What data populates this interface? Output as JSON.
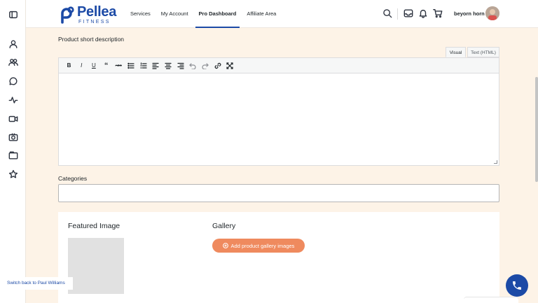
{
  "brand": {
    "name": "Pellea",
    "sub": "FITNESS",
    "color": "#1c4aa6"
  },
  "sidebar": {
    "icons": [
      "sidebar-toggle-icon",
      "user-icon",
      "group-icon",
      "chat-icon",
      "activity-icon",
      "video-icon",
      "camera-icon",
      "folder-icon",
      "star-icon"
    ]
  },
  "nav": {
    "items": [
      {
        "label": "Services"
      },
      {
        "label": "My Account"
      },
      {
        "label": "Pro Dashboard",
        "active": true
      },
      {
        "label": "Affiliate Area"
      }
    ]
  },
  "header": {
    "icons": [
      "search-icon",
      "inbox-icon",
      "bell-icon",
      "cart-icon"
    ],
    "user_name": "beyorn horn"
  },
  "form": {
    "short_description_label": "Product short description",
    "tab_visual": "Visual",
    "tab_text": "Text (HTML)",
    "toolbar": [
      "bold",
      "italic",
      "underline",
      "blockquote",
      "strikethrough",
      "bullet-list",
      "numbered-list",
      "align-left",
      "align-center",
      "align-right",
      "undo",
      "redo",
      "link",
      "fullscreen"
    ],
    "categories_label": "Categories",
    "categories_value": ""
  },
  "media": {
    "featured_title": "Featured Image",
    "gallery_title": "Gallery",
    "gallery_button": "Add product gallery images",
    "accent": "#ef8a5e"
  },
  "footer": {
    "switch_back": "Switch back to Paul Williams",
    "phone_color": "#1c4aa6"
  }
}
